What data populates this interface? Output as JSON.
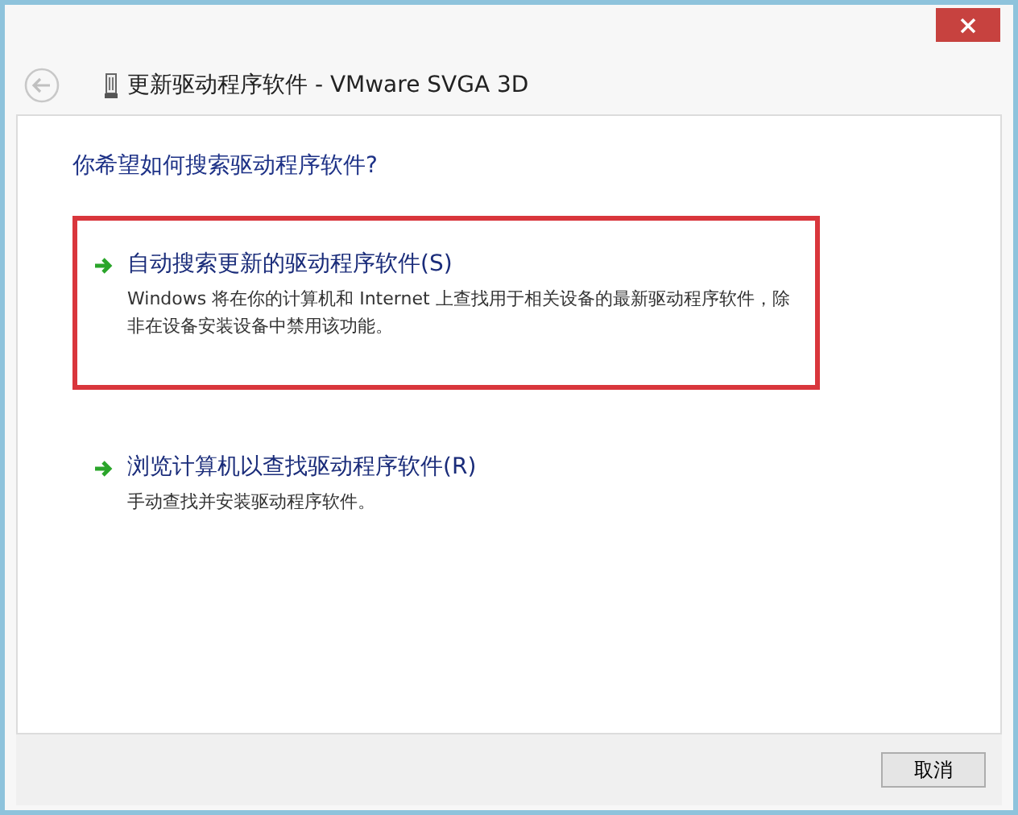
{
  "window": {
    "title": "更新驱动程序软件 - VMware SVGA 3D"
  },
  "question": "你希望如何搜索驱动程序软件?",
  "options": [
    {
      "title": "自动搜索更新的驱动程序软件(S)",
      "description": "Windows 将在你的计算机和 Internet 上查找用于相关设备的最新驱动程序软件，除非在设备安装设备中禁用该功能。",
      "highlighted": true
    },
    {
      "title": "浏览计算机以查找驱动程序软件(R)",
      "description": "手动查找并安装驱动程序软件。",
      "highlighted": false
    }
  ],
  "buttons": [
    "取消"
  ]
}
